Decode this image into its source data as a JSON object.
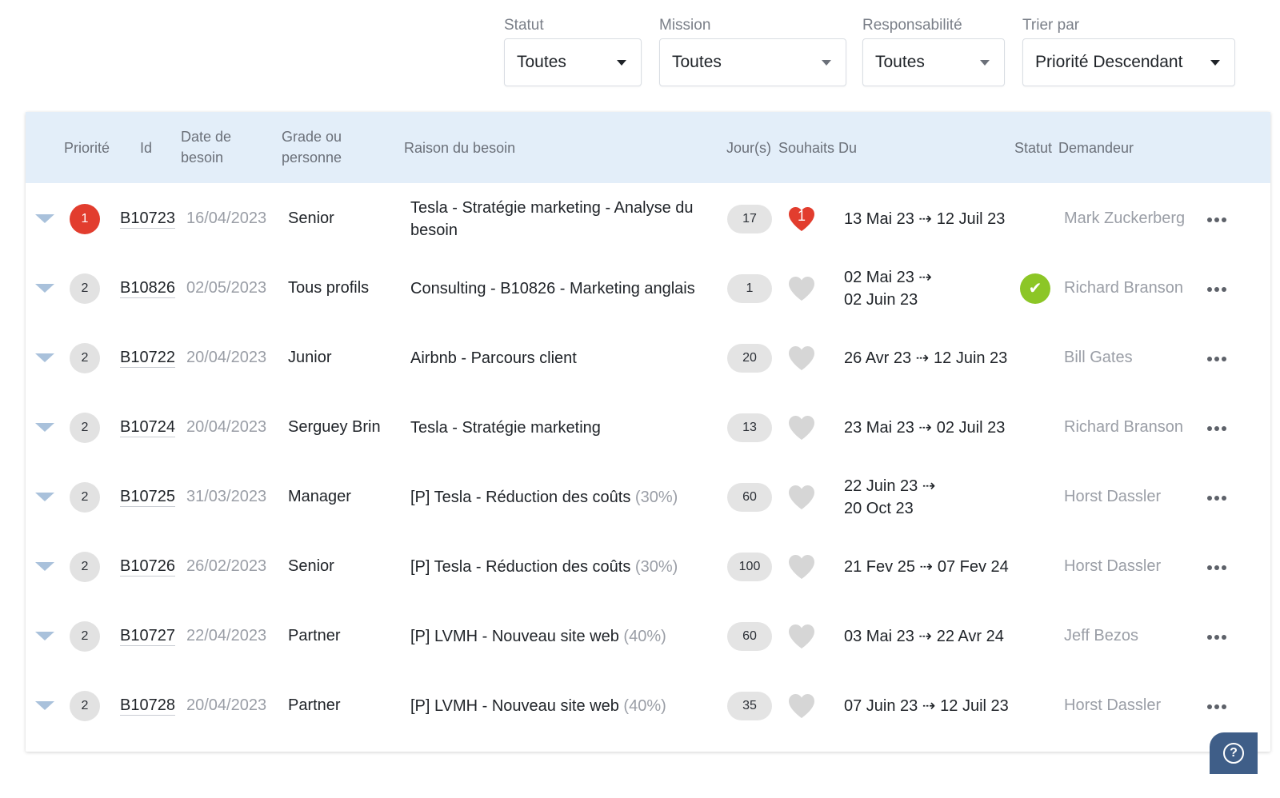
{
  "filters": [
    {
      "label": "Statut",
      "value": "Toutes"
    },
    {
      "label": "Mission",
      "value": "Toutes"
    },
    {
      "label": "Responsabilité",
      "value": "Toutes"
    },
    {
      "label": "Trier par",
      "value": "Priorité Descendant"
    }
  ],
  "table": {
    "headers": {
      "priority": "Priorité",
      "id": "Id",
      "date_line1": "Date de",
      "date_line2": "besoin",
      "grade_line1": "Grade ou",
      "grade_line2": "personne",
      "reason": "Raison du besoin",
      "days": "Jour(s)",
      "wishes": "Souhaits",
      "period": "Du",
      "status": "Statut",
      "requester": "Demandeur"
    },
    "rows": [
      {
        "priority": "1",
        "high": true,
        "id": "B10723",
        "date": "16/04/2023",
        "grade": "Senior",
        "reason": "Tesla - Stratégie marketing - Analyse du besoin",
        "pct": "",
        "days": "17",
        "wish": "1",
        "period_line1": "13 Mai 23 ⇢ 12 Juil 23",
        "period_line2": "",
        "status_ok": false,
        "requester": "Mark Zuckerberg"
      },
      {
        "priority": "2",
        "high": false,
        "id": "B10826",
        "date": "02/05/2023",
        "grade": "Tous profils",
        "reason": "Consulting - B10826 - Marketing anglais",
        "pct": "",
        "days": "1",
        "wish": "",
        "period_line1": "02 Mai 23 ⇢",
        "period_line2": "02 Juin 23",
        "status_ok": true,
        "requester": "Richard Branson"
      },
      {
        "priority": "2",
        "high": false,
        "id": "B10722",
        "date": "20/04/2023",
        "grade": "Junior",
        "reason": "Airbnb - Parcours client",
        "pct": "",
        "days": "20",
        "wish": "",
        "period_line1": "26 Avr 23 ⇢ 12 Juin 23",
        "period_line2": "",
        "status_ok": false,
        "requester": "Bill Gates"
      },
      {
        "priority": "2",
        "high": false,
        "id": "B10724",
        "date": "20/04/2023",
        "grade": "Serguey Brin",
        "reason": "Tesla - Stratégie marketing",
        "pct": "",
        "days": "13",
        "wish": "",
        "period_line1": "23 Mai 23 ⇢ 02 Juil 23",
        "period_line2": "",
        "status_ok": false,
        "requester": "Richard Branson"
      },
      {
        "priority": "2",
        "high": false,
        "id": "B10725",
        "date": "31/03/2023",
        "grade": "Manager",
        "reason": "[P] Tesla - Réduction des coûts",
        "pct": "(30%)",
        "days": "60",
        "wish": "",
        "period_line1": "22 Juin 23 ⇢",
        "period_line2": "20 Oct 23",
        "status_ok": false,
        "requester": "Horst Dassler"
      },
      {
        "priority": "2",
        "high": false,
        "id": "B10726",
        "date": "26/02/2023",
        "grade": "Senior",
        "reason": "[P] Tesla - Réduction des coûts",
        "pct": "(30%)",
        "days": "100",
        "wish": "",
        "period_line1": "21 Fev 25 ⇢ 07 Fev 24",
        "period_line2": "",
        "status_ok": false,
        "requester": "Horst Dassler"
      },
      {
        "priority": "2",
        "high": false,
        "id": "B10727",
        "date": "22/04/2023",
        "grade": "Partner",
        "reason": "[P] LVMH - Nouveau site web",
        "pct": "(40%)",
        "days": "60",
        "wish": "",
        "period_line1": "03 Mai 23 ⇢ 22 Avr 24",
        "period_line2": "",
        "status_ok": false,
        "requester": "Jeff Bezos"
      },
      {
        "priority": "2",
        "high": false,
        "id": "B10728",
        "date": "20/04/2023",
        "grade": "Partner",
        "reason": "[P] LVMH - Nouveau site web",
        "pct": "(40%)",
        "days": "35",
        "wish": "",
        "period_line1": "07 Juin 23 ⇢ 12 Juil 23",
        "period_line2": "",
        "status_ok": false,
        "requester": "Horst Dassler"
      }
    ]
  },
  "icons": {
    "expand": "chevron-down-icon",
    "wish": "heart-icon",
    "status": "check-icon",
    "more": "more-icon",
    "help": "help-icon"
  },
  "colors": {
    "header_bg": "#e3eef9",
    "priority_high": "#e23d2e",
    "heart_active": "#e23d2e",
    "heart_inactive": "#d6d6d6",
    "status_ok": "#8cc626",
    "help_bg": "#3f5e88"
  },
  "help": {
    "symbol": "?"
  }
}
